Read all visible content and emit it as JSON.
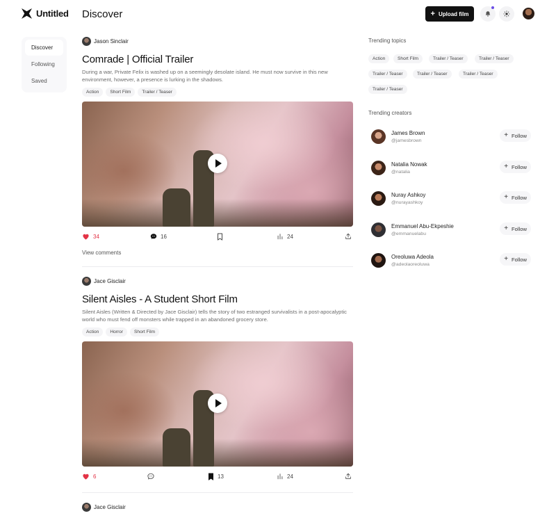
{
  "app": {
    "name": "Untitled"
  },
  "header": {
    "title": "Discover",
    "upload_label": "Upload film",
    "colors": {
      "notification_dot": "#6b4ee6",
      "primary": "#111111"
    }
  },
  "sidebar": {
    "items": [
      {
        "label": "Discover"
      },
      {
        "label": "Following"
      },
      {
        "label": "Saved"
      }
    ]
  },
  "posts": [
    {
      "author": "Jason Sinclair",
      "title": "Comrade | Official Trailer",
      "description": "During a war, Private Felix is washed up on a seemingly desolate island. He must now survive in this new environment, however, a presence is lurking in the shadows.",
      "tags": [
        "Action",
        "Short Film",
        "Trailer / Teaser"
      ],
      "likes": "34",
      "comments": "16",
      "views": "24",
      "liked": true,
      "bookmarked": false,
      "bookmarks": "",
      "view_comments": "View comments"
    },
    {
      "author": "Jace Gisclair",
      "title": "Silent Aisles - A Student Short Film",
      "description": "Silent Aisles (Written & Directed by Jace Gisclair) tells the story of two estranged survivalists in a post-apocalyptic world who must fend off monsters while trapped in an abandoned grocery store.",
      "tags": [
        "Action",
        "Horror",
        "Short Film"
      ],
      "likes": "6",
      "comments": "",
      "views": "24",
      "liked": true,
      "bookmarked": true,
      "bookmarks": "13"
    },
    {
      "author": "Jace Gisclair"
    }
  ],
  "trending_topics": {
    "title": "Trending topics",
    "items": [
      "Action",
      "Short Film",
      "Trailer / Teaser",
      "Trailer / Teaser",
      "Trailer / Teaser",
      "Trailer / Teaser",
      "Trailer / Teaser",
      "Trailer / Teaser"
    ]
  },
  "trending_creators": {
    "title": "Trending creators",
    "follow_label": "Follow",
    "items": [
      {
        "name": "James Brown",
        "handle": "@jamesbrown"
      },
      {
        "name": "Natalia Nowak",
        "handle": "@natalia"
      },
      {
        "name": "Nuray Ashkoy",
        "handle": "@nurayashkoy"
      },
      {
        "name": "Emmanuel Abu-Ekpeshie",
        "handle": "@emmanuelabu"
      },
      {
        "name": "Oreoluwa Adeola",
        "handle": "@adeolaoreoluwa"
      }
    ]
  },
  "icons": {
    "logo": "logo-mark-icon",
    "bell": "bell-icon",
    "theme": "sun-icon",
    "like": "heart-icon",
    "comment": "comment-bubble-icon",
    "bookmark": "bookmark-icon",
    "views": "bar-chart-icon",
    "share": "share-icon",
    "play": "play-icon",
    "plus": "plus-icon"
  }
}
